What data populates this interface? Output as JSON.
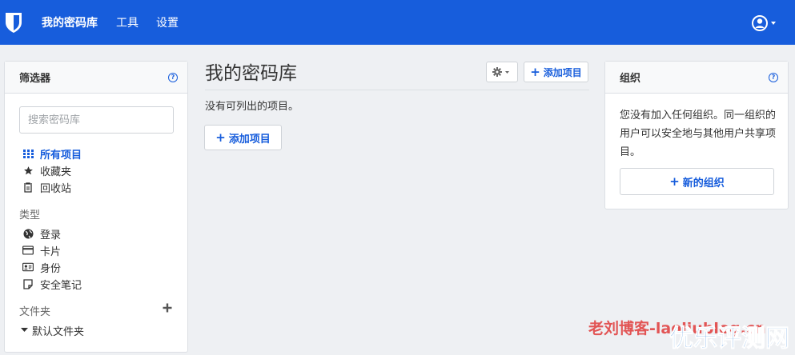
{
  "nav": {
    "items": [
      {
        "label": "我的密码库",
        "active": true
      },
      {
        "label": "工具",
        "active": false
      },
      {
        "label": "设置",
        "active": false
      }
    ],
    "brand_color": "#175ddc"
  },
  "filter": {
    "title": "筛选器",
    "search_placeholder": "搜索密码库",
    "items": [
      {
        "label": "所有项目",
        "icon": "grid-icon",
        "active": true
      },
      {
        "label": "收藏夹",
        "icon": "star-icon",
        "active": false
      },
      {
        "label": "回收站",
        "icon": "trash-icon",
        "active": false
      }
    ],
    "types_label": "类型",
    "types": [
      {
        "label": "登录",
        "icon": "globe-icon"
      },
      {
        "label": "卡片",
        "icon": "credit-card-icon"
      },
      {
        "label": "身份",
        "icon": "id-card-icon"
      },
      {
        "label": "安全笔记",
        "icon": "note-icon"
      }
    ],
    "folders_label": "文件夹",
    "folder_items": [
      {
        "label": "默认文件夹",
        "icon": "caret-down-icon"
      }
    ]
  },
  "main": {
    "title": "我的密码库",
    "add_item_label": "添加项目",
    "empty_message": "没有可列出的项目。",
    "empty_add_label": "添加项目"
  },
  "org": {
    "title": "组织",
    "description": "您没有加入任何组织。同一组织的用户可以安全地与其他用户共享项目。",
    "new_org_label": "新的组织"
  },
  "watermarks": {
    "blog": "老刘博客-laoliublog.cn",
    "brand": "优乐评测网"
  }
}
